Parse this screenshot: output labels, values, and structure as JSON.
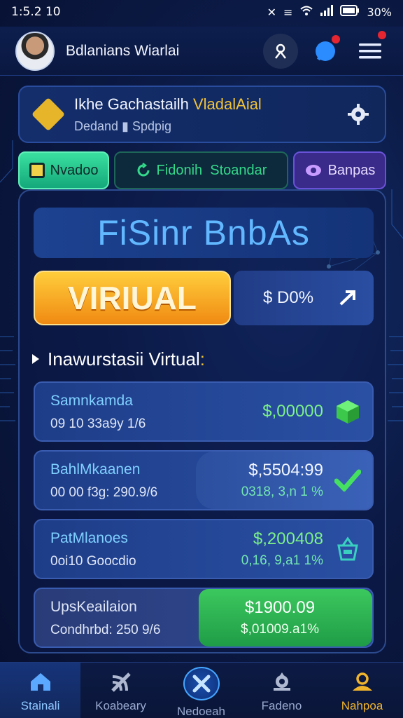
{
  "status_bar": {
    "time": "1:5.2 10",
    "battery": "30%"
  },
  "header": {
    "user_name": "Bdlanians Wiarlai",
    "icons": [
      "avatar",
      "profile-icon",
      "chat-icon",
      "menu-icon"
    ]
  },
  "promo": {
    "title_white": "Ikhe Gachastailh ",
    "title_gold": "VladalAial",
    "subtitle": "Dedand ▮ Spdpig",
    "icon": "diamond-icon"
  },
  "tabs": [
    {
      "label": "Nvadoo",
      "icon": "square-icon"
    },
    {
      "label": "Fidonih  Stoandar",
      "icon": "refresh-icon"
    },
    {
      "label": "Banpas",
      "icon": "gamepad-icon"
    }
  ],
  "hero": {
    "title": "FiSinr BnbAs",
    "badge": "VIRIUAL",
    "percent": "$ D0%"
  },
  "section": {
    "title": "Inawurstasii Virtual",
    "accent": ":"
  },
  "items": [
    {
      "name": "Samnkamda",
      "detail": "09 10 33a9y 1/6",
      "amount": "$,00000",
      "change": "",
      "icon": "cube-icon"
    },
    {
      "name": "BahlMkaanen",
      "detail": "00 00 f3g: 290.9/6",
      "amount": "$,5504:99",
      "change": "0318, 3,n 1 %",
      "icon": "check-icon"
    },
    {
      "name": "PatMlanoes",
      "detail": "0oi10 Goocdio",
      "amount": "$,200408",
      "change": "0,16, 9,a1 1%",
      "icon": "basket-icon"
    },
    {
      "name": "UpsKeailaion",
      "detail": "Condhrbd: 250 9/6",
      "amount": "$1900.09",
      "change": "$,01009.a1%",
      "icon": ""
    }
  ],
  "bottom_nav": [
    {
      "label": "Stainali",
      "icon": "home-icon"
    },
    {
      "label": "Koabeary",
      "icon": "signal-icon"
    },
    {
      "label": "Nedoeah",
      "icon": "tools-icon"
    },
    {
      "label": "Fadeno",
      "icon": "gear-icon"
    },
    {
      "label": "Nahpoa",
      "icon": "person-icon"
    }
  ],
  "colors": {
    "background": "#0b1a45",
    "accent_gold": "#f0c23a",
    "accent_green": "#3cc85e",
    "accent_blue": "#62b8ff"
  }
}
